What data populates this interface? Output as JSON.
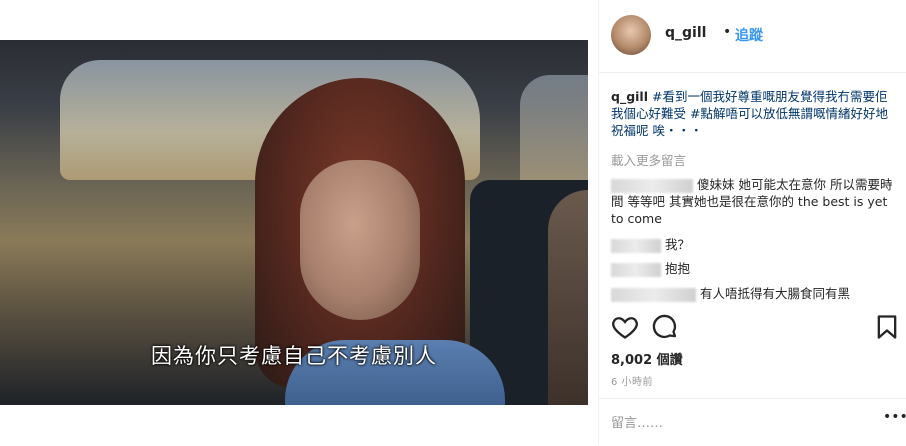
{
  "post": {
    "subtitle": "因為你只考慮自己不考慮別人"
  },
  "header": {
    "username": "q_gill",
    "separator": "•",
    "follow_label": "追蹤"
  },
  "caption": {
    "username": "q_gill",
    "text": " #看到一個我好尊重嘅朋友覺得我冇需要佢我個心好難受 #點解唔可以放低無謂嘅情緒好好地祝福呢 唉・・・"
  },
  "load_more": "載入更多留言",
  "comments": [
    {
      "text": "傻妹妹 她可能太在意你 所以需要時間 等等吧 其實她也是很在意你的 the best is yet to come"
    },
    {
      "text": "我？"
    },
    {
      "text": "抱抱"
    },
    {
      "text": "有人唔抵得有大腸食同有黑"
    }
  ],
  "stats": {
    "likes": "8,002 個讚",
    "time": "6 小時前"
  },
  "composer": {
    "placeholder": "留言……",
    "more": "•••"
  },
  "icons": [
    "heart-icon",
    "comment-icon",
    "bookmark-icon",
    "more-options-icon"
  ],
  "colors": {
    "link": "#3897f0",
    "caption_text": "#003569",
    "muted": "#999999"
  }
}
